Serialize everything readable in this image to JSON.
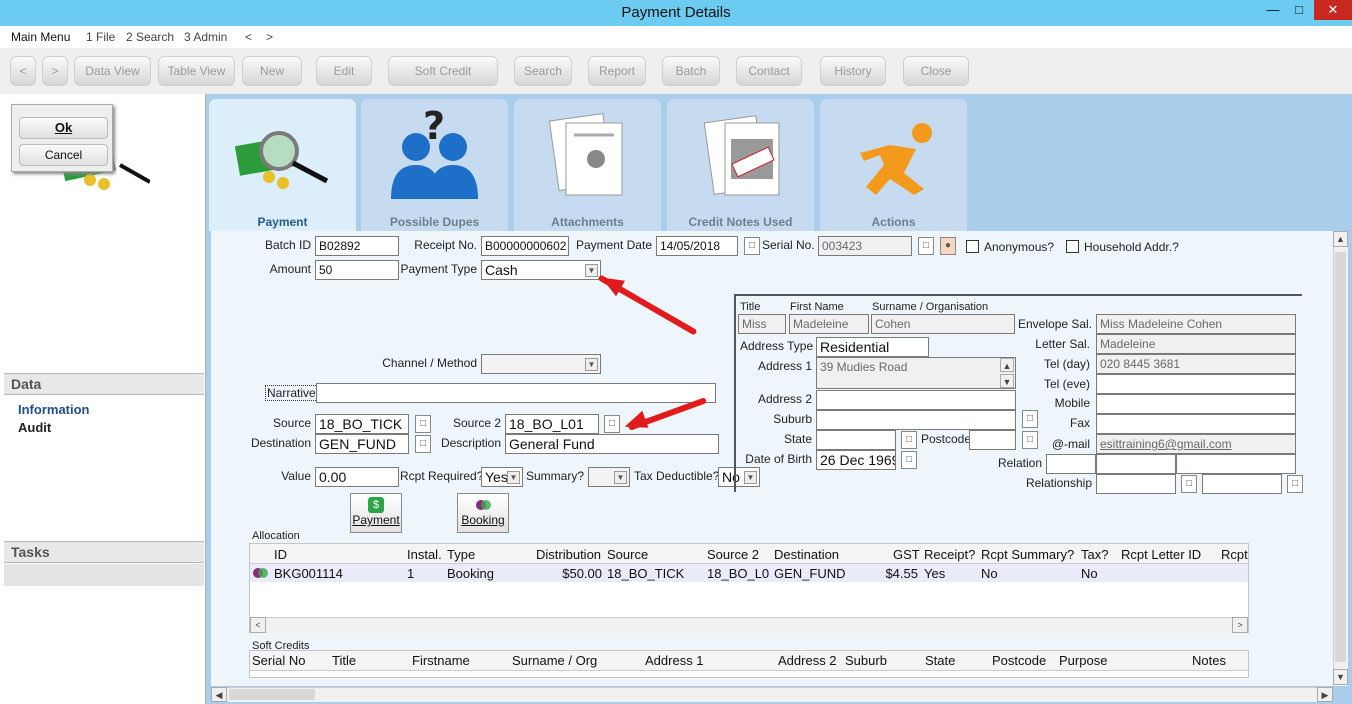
{
  "window": {
    "title": "Payment Details"
  },
  "menu": [
    "Main Menu",
    "1 File",
    "2 Search",
    "3 Admin",
    "<",
    ">"
  ],
  "toolbar": {
    "back": "<",
    "forward": ">",
    "buttons": [
      "Data View",
      "Table View",
      "New",
      "Edit",
      "Soft Credit",
      "Search",
      "Report",
      "Batch",
      "Contact",
      "History",
      "Close"
    ]
  },
  "dialog": {
    "ok": "Ok",
    "cancel": "Cancel"
  },
  "sidebar": {
    "data_header": "Data",
    "items": [
      "Information",
      "Audit"
    ],
    "tasks_header": "Tasks"
  },
  "tabs": [
    "Payment",
    "Possible Dupes",
    "Attachments",
    "Credit Notes Used",
    "Actions"
  ],
  "form": {
    "batch_id_label": "Batch ID",
    "batch_id": "B02892",
    "receipt_no_label": "Receipt No.",
    "receipt_no": "B00000000602",
    "payment_date_label": "Payment Date",
    "payment_date": "14/05/2018",
    "serial_no_label": "Serial No.",
    "serial_no": "003423",
    "anonymous_label": "Anonymous?",
    "household_label": "Household Addr.?",
    "amount_label": "Amount",
    "amount": "50",
    "payment_type_label": "Payment Type",
    "payment_type": "Cash",
    "channel_label": "Channel / Method",
    "channel": "",
    "narrative_label": "Narrative",
    "narrative": "",
    "source_label": "Source",
    "source": "18_BO_TICK",
    "source2_label": "Source 2",
    "source2": "18_BO_L01",
    "destination_label": "Destination",
    "destination": "GEN_FUND",
    "description_label": "Description",
    "description": "General Fund",
    "value_label": "Value",
    "value": "0.00",
    "rcpt_required_label": "Rcpt Required?",
    "rcpt_required": "Yes",
    "summary_label": "Summary?",
    "summary": "",
    "tax_deductible_label": "Tax Deductible?",
    "tax_deductible": "No",
    "payment_btn": "Payment",
    "booking_btn": "Booking"
  },
  "contact": {
    "title_label": "Title",
    "first_name_label": "First Name",
    "surname_label": "Surname / Organisation",
    "title": "Miss",
    "first_name": "Madeleine",
    "surname": "Cohen",
    "address_type_label": "Address Type",
    "address_type": "Residential",
    "address1_label": "Address 1",
    "address1": "39 Mudies Road",
    "address2_label": "Address 2",
    "address2": "",
    "suburb_label": "Suburb",
    "suburb": "",
    "state_label": "State",
    "state": "",
    "postcode_label": "Postcode",
    "postcode": "",
    "dob_label": "Date of Birth",
    "dob": "26 Dec 1969",
    "envelope_sal_label": "Envelope Sal.",
    "envelope_sal": "Miss Madeleine Cohen",
    "letter_sal_label": "Letter Sal.",
    "letter_sal": "Madeleine",
    "tel_day_label": "Tel (day)",
    "tel_day": "020 8445 3681",
    "tel_eve_label": "Tel (eve)",
    "tel_eve": "",
    "mobile_label": "Mobile",
    "mobile": "",
    "fax_label": "Fax",
    "fax": "",
    "email_label": "@-mail",
    "email": "esittraining6@gmail.com",
    "relation_label": "Relation",
    "relationship_label": "Relationship"
  },
  "allocation": {
    "label": "Allocation",
    "columns": [
      "ID",
      "Instal.",
      "Type",
      "Distribution",
      "Source",
      "Source 2",
      "Destination",
      "GST",
      "Receipt?",
      "Rcpt Summary?",
      "Tax?",
      "Rcpt Letter ID",
      "Rcpt"
    ],
    "rows": [
      [
        "BKG001114",
        "1",
        "Booking",
        "$50.00",
        "18_BO_TICK",
        "18_BO_L0",
        "GEN_FUND",
        "$4.55",
        "Yes",
        "No",
        "No",
        "",
        ""
      ]
    ]
  },
  "soft_credits": {
    "label": "Soft Credits",
    "columns": [
      "Serial No",
      "Title",
      "Firstname",
      "Surname / Org",
      "Address 1",
      "Address 2",
      "Suburb",
      "State",
      "Postcode",
      "Purpose",
      "Notes"
    ]
  },
  "colors": {
    "title_bar": "#6ccbf0",
    "tab_active_text": "#215c93",
    "form_bg": "#eef5fb",
    "annotation_arrow": "#e11b1b"
  }
}
